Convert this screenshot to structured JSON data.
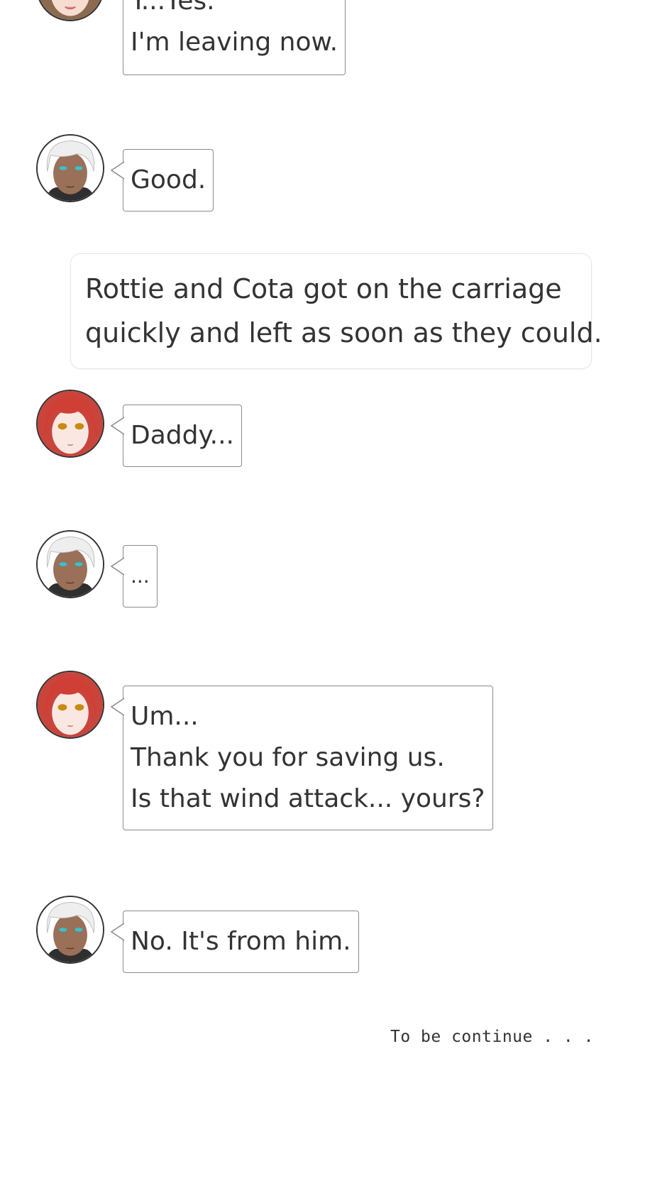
{
  "messages": [
    {
      "speaker": "woman-brown-hair",
      "lines": [
        "Y...Yes.",
        "I'm leaving now."
      ]
    },
    {
      "speaker": "man-white-hair",
      "lines": [
        "Good."
      ]
    },
    {
      "speaker": "narration",
      "lines": [
        "Rottie and Cota got on the carriage",
        "quickly and left as soon as they could."
      ]
    },
    {
      "speaker": "girl-red-hair",
      "lines": [
        "Daddy..."
      ]
    },
    {
      "speaker": "man-white-hair",
      "lines": [
        "..."
      ]
    },
    {
      "speaker": "girl-red-hair",
      "lines": [
        "Um...",
        "Thank you for saving us.",
        "Is that wind attack... yours?"
      ]
    },
    {
      "speaker": "man-white-hair",
      "lines": [
        "No. It's from him."
      ]
    }
  ],
  "footer": {
    "text": "To be continue . . ."
  },
  "colors": {
    "bubble_border": "#8a8a8a",
    "narration_border": "#e6e6e6",
    "text": "#333333",
    "background": "#ffffff"
  },
  "icons": {
    "white_hair_avatar": "white-haired-man-avatar-icon",
    "red_hair_avatar": "red-haired-girl-avatar-icon",
    "brown_hair_avatar": "brown-haired-woman-avatar-icon"
  }
}
